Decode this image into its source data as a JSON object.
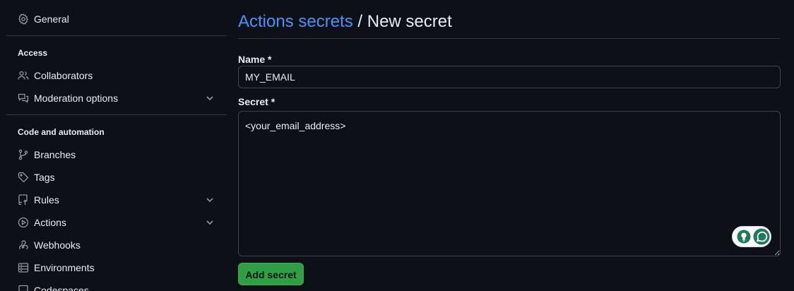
{
  "sidebar": {
    "top_item": {
      "label": "General",
      "icon": "gear-icon"
    },
    "sections": [
      {
        "heading": "Access",
        "items": [
          {
            "label": "Collaborators",
            "icon": "people-icon"
          },
          {
            "label": "Moderation options",
            "icon": "comment-discussion-icon",
            "expandable": true
          }
        ]
      },
      {
        "heading": "Code and automation",
        "items": [
          {
            "label": "Branches",
            "icon": "git-branch-icon"
          },
          {
            "label": "Tags",
            "icon": "tag-icon"
          },
          {
            "label": "Rules",
            "icon": "repo-push-icon",
            "expandable": true
          },
          {
            "label": "Actions",
            "icon": "play-icon",
            "expandable": true
          },
          {
            "label": "Webhooks",
            "icon": "webhook-icon"
          },
          {
            "label": "Environments",
            "icon": "server-icon"
          },
          {
            "label": "Codespaces",
            "icon": "codespaces-icon"
          }
        ]
      }
    ]
  },
  "main": {
    "breadcrumb": {
      "parent": "Actions secrets",
      "separator": "/",
      "current": "New secret"
    },
    "form": {
      "name_label": "Name *",
      "name_value": "MY_EMAIL",
      "secret_label": "Secret *",
      "secret_value": "<your_email_address>",
      "submit_label": "Add secret"
    }
  },
  "colors": {
    "background": "#0d1117",
    "text": "#e6edf3",
    "link": "#4493f8",
    "border": "#30363d",
    "primary_button": "#2ea043",
    "extension_accent": "#1f7a5c"
  }
}
